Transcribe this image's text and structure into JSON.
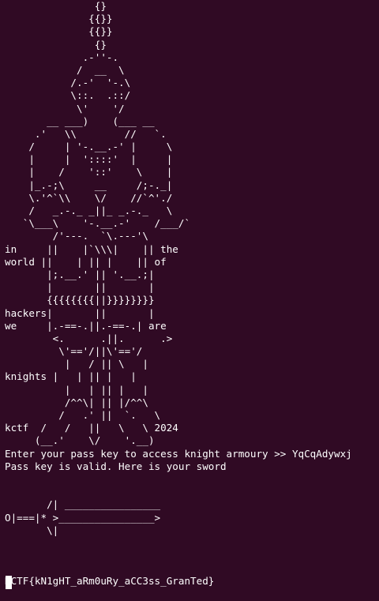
{
  "terminal": {
    "background": "#300a24",
    "foreground": "#ffffff",
    "lines": [
      "               {}",
      "              {{}}",
      "              {{}}",
      "               {}",
      "             .-''-.",
      "            /  __  \\",
      "           /.-'  '-.\\",
      "           \\::.  .::/",
      "            \\'    '/",
      "       __ ___)    (___ __",
      "     .'   \\\\        //   `.",
      "    /     | '-.__.-' |     \\",
      "    |     |  '::::'  |     |",
      "    |    /    '::'    \\    |",
      "    |_.-;\\     __     /;-._|",
      "    \\.'^`\\\\    \\/    //`^'./",
      "    /   _.-._ _||_ _.-._   \\",
      "   `\\___\\    '-.__.-'    /___/`",
      "        /'---.  `\\.---'\\",
      "in     ||    |`\\\\\\|    || the",
      "world ||    | || |    || of",
      "       |;.__.' || '.__.;|",
      "       |       ||       |",
      "       {{{{{{{{||}}}}}}}}",
      "hackers|       ||       |",
      "we     |.-==-.||.-==-.| are",
      "        <.      .||.      .>",
      "         \\'=='/||\\'=='/",
      "          |   / || \\   |",
      "knights |   | || |   |",
      "          |   | || |   |",
      "          /^^\\| || |/^^\\",
      "         /   .' ||  `.   \\",
      "kctf  /   /   ||   \\   \\ 2024",
      "     (__.'    \\/    '.__)",
      "Enter your pass key to access knight armoury >> YqCqAdywxj",
      "Pass key is valid. Here is your sword",
      "",
      "",
      "       /| ________________",
      "O|===|* >________________>",
      "       \\|",
      "",
      "",
      "",
      "KCTF{kN1gHT_aRm0uRy_aCC3ss_GranTed}"
    ]
  }
}
